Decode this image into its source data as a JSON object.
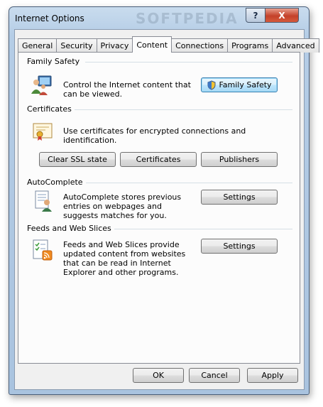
{
  "window": {
    "title": "Internet Options",
    "help_label": "?",
    "close_label": "X",
    "watermark": "SOFTPEDIA"
  },
  "tabs": [
    {
      "label": "General"
    },
    {
      "label": "Security"
    },
    {
      "label": "Privacy"
    },
    {
      "label": "Content",
      "active": true
    },
    {
      "label": "Connections"
    },
    {
      "label": "Programs"
    },
    {
      "label": "Advanced"
    }
  ],
  "family_safety": {
    "title": "Family Safety",
    "description": "Control the Internet content that can be viewed.",
    "button": "Family Safety",
    "icon": "family-safety-icon"
  },
  "certificates": {
    "title": "Certificates",
    "description": "Use certificates for encrypted connections and identification.",
    "buttons": {
      "clear_ssl": "Clear SSL state",
      "certificates": "Certificates",
      "publishers": "Publishers"
    },
    "icon": "certificate-icon"
  },
  "autocomplete": {
    "title": "AutoComplete",
    "description": "AutoComplete stores previous entries on webpages and suggests matches for you.",
    "button": "Settings",
    "icon": "autocomplete-icon"
  },
  "feeds": {
    "title": "Feeds and Web Slices",
    "description": "Feeds and Web Slices provide updated content from websites that can be read in Internet Explorer and other programs.",
    "button": "Settings",
    "icon": "feeds-icon"
  },
  "footer": {
    "ok": "OK",
    "cancel": "Cancel",
    "apply": "Apply"
  },
  "colors": {
    "accent": "#3c7fb1",
    "close": "#c4412a",
    "panel": "#fcfcfc"
  }
}
